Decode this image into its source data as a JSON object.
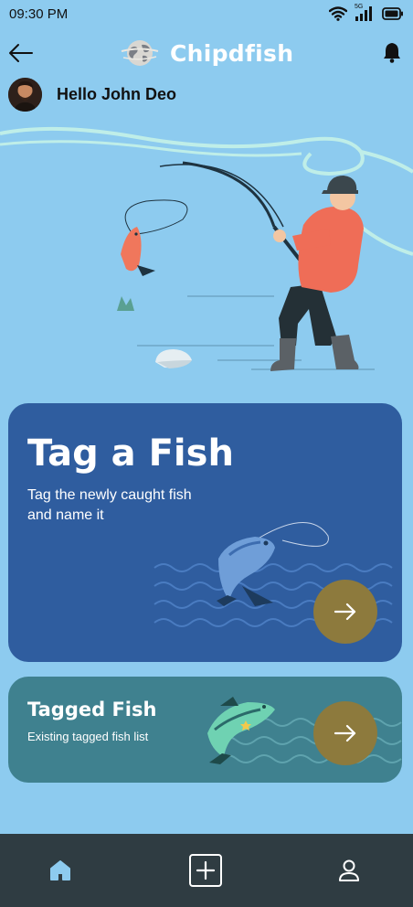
{
  "status_bar": {
    "time": "09:30 PM",
    "network": "5G"
  },
  "header": {
    "app_name": "Chipdfish"
  },
  "greeting": {
    "text": "Hello John Deo"
  },
  "cards": {
    "tag": {
      "title": "Tag a Fish",
      "subtitle": "Tag the newly caught fish and name it"
    },
    "tagged": {
      "title": "Tagged Fish",
      "subtitle": "Existing tagged fish list"
    }
  },
  "icons": {
    "back": "arrow-left-icon",
    "bell": "bell-icon",
    "arrow": "arrow-right-icon",
    "home": "home-icon",
    "add": "plus-square-icon",
    "profile": "user-icon"
  },
  "colors": {
    "background": "#8dcbef",
    "tag_card": "#2f5d9f",
    "tagged_card": "#3f818f",
    "arrow_button": "#8d7a3d",
    "nav_bar": "#2f3c42",
    "active_nav": "#8dcbef"
  }
}
